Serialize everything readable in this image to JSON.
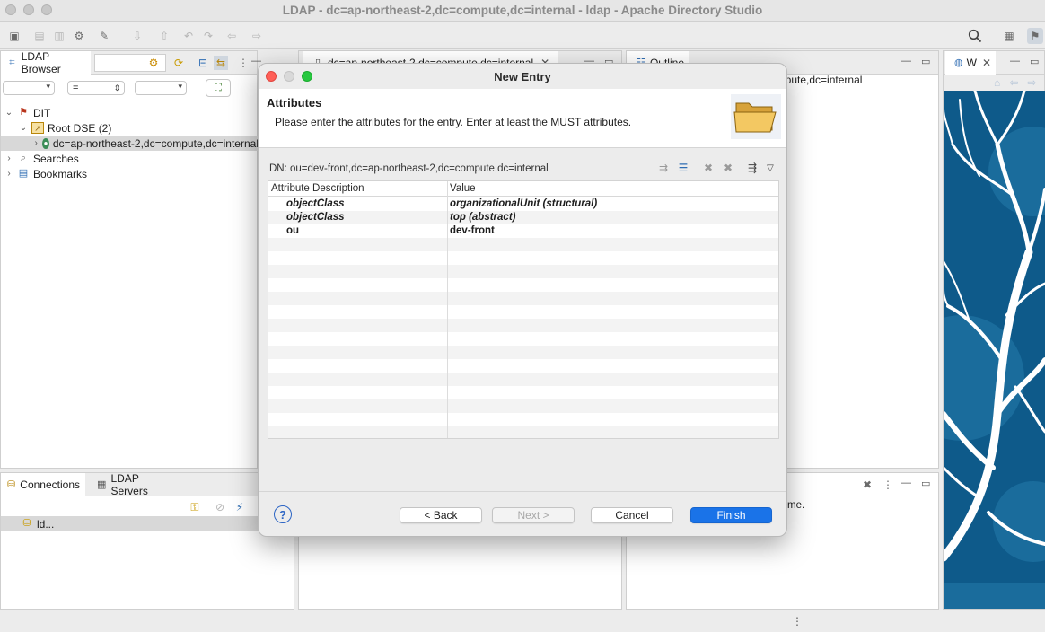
{
  "window": {
    "title": "LDAP - dc=ap-northeast-2,dc=compute,dc=internal - ldap - Apache Directory Studio"
  },
  "ldap_browser": {
    "tab_label": "LDAP Browser",
    "filter_operator": "=",
    "tree": {
      "dit_label": "DIT",
      "root_dse_label": "Root DSE (2)",
      "entry_label": "dc=ap-northeast-2,dc=compute,dc=internal",
      "searches_label": "Searches",
      "bookmarks_label": "Bookmarks"
    }
  },
  "editor": {
    "tab_label": "dc=ap-northeast-2,dc=compute,dc=internal"
  },
  "outline": {
    "tab_label": "Outline",
    "content_text": "npute,dc=internal"
  },
  "welcome": {
    "tab_label": "W"
  },
  "connections": {
    "tab_label": "Connections",
    "servers_tab_label": "LDAP Servers",
    "item_label": "ld..."
  },
  "bottom_right": {
    "text": "me."
  },
  "dialog": {
    "title": "New Entry",
    "header_title": "Attributes",
    "header_description": "Please enter the attributes for the entry. Enter at least the MUST attributes.",
    "dn_text": "DN: ou=dev-front,dc=ap-northeast-2,dc=compute,dc=internal",
    "table": {
      "headers": [
        "Attribute Description",
        "Value"
      ],
      "rows": [
        {
          "attribute": "objectClass",
          "value": "organizationalUnit (structural)",
          "italic": true
        },
        {
          "attribute": "objectClass",
          "value": "top (abstract)",
          "italic": true
        },
        {
          "attribute": "ou",
          "value": "dev-front",
          "italic": false
        }
      ]
    },
    "buttons": {
      "back": "< Back",
      "next": "Next >",
      "cancel": "Cancel",
      "finish": "Finish"
    }
  },
  "colors": {
    "accent": "#1a73e8",
    "close": "#ff5f57",
    "zoom": "#28c840",
    "wallpaper": "#0e5a8a"
  }
}
